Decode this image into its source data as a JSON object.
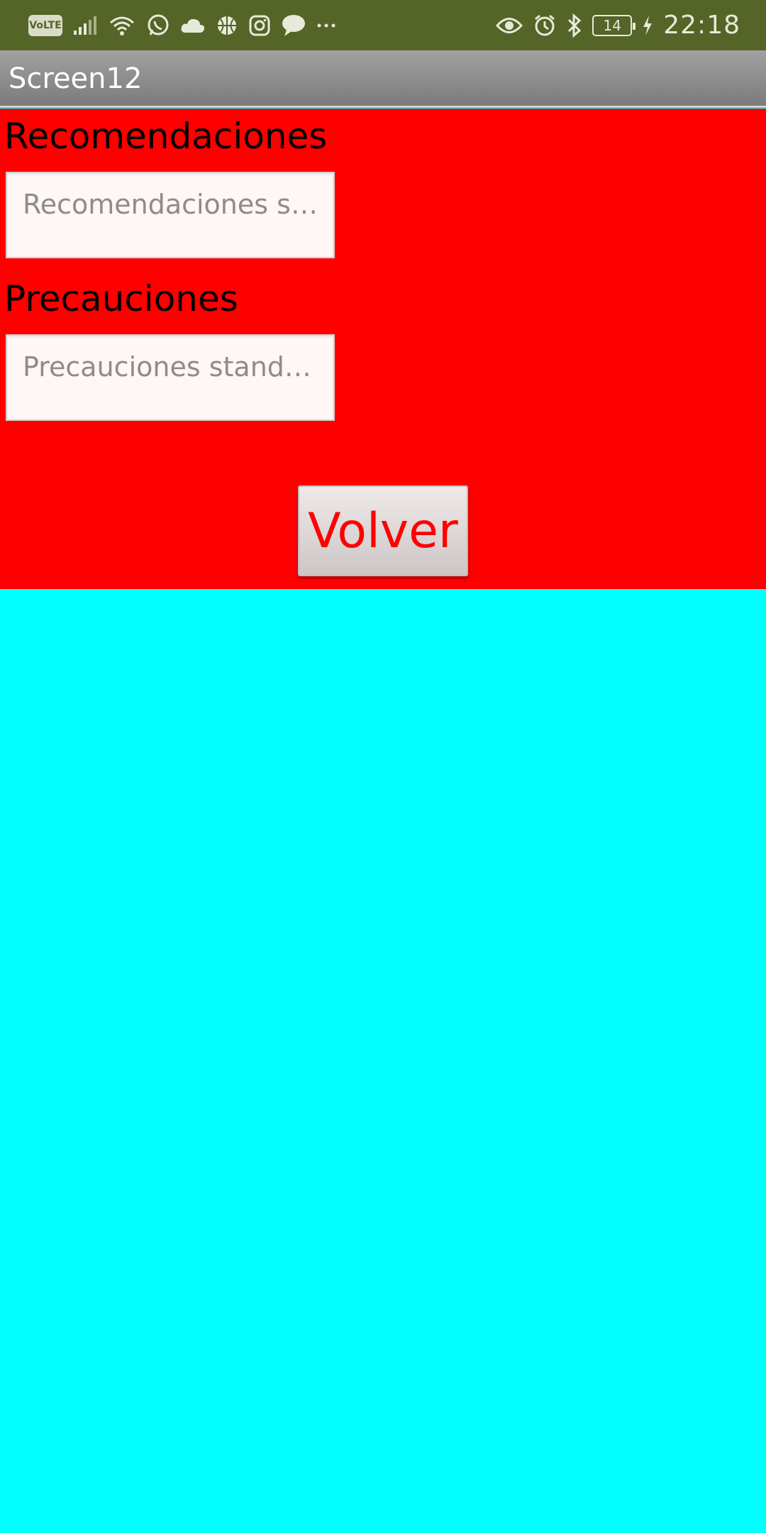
{
  "status_bar": {
    "volte_label": "VoLTE",
    "battery_level": "14",
    "time": "22:18",
    "left_icons": [
      "volte-icon",
      "signal-icon",
      "wifi-icon",
      "whatsapp-icon",
      "cloud-icon",
      "basketball-icon",
      "instagram-icon",
      "chat-bubble-icon",
      "more-icon"
    ],
    "right_icons": [
      "eye-icon",
      "alarm-icon",
      "bluetooth-icon",
      "battery-icon",
      "charging-icon"
    ]
  },
  "title_bar": {
    "title": "Screen12"
  },
  "form": {
    "recomendaciones_label": "Recomendaciones",
    "recomendaciones_placeholder": "Recomendaciones standar",
    "precauciones_label": "Precauciones",
    "precauciones_placeholder": "Precauciones standar...",
    "volver_label": "Volver"
  },
  "colors": {
    "status_bar": "#556427",
    "title_bar": "#8e8e8e",
    "panel": "#ff0000",
    "background": "#00ffff",
    "button_text": "#ff0000"
  }
}
